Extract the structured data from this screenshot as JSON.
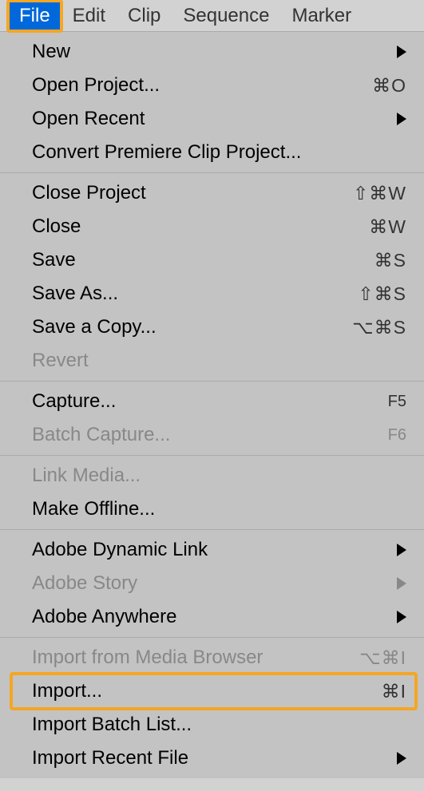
{
  "menubar": {
    "file": "File",
    "edit": "Edit",
    "clip": "Clip",
    "sequence": "Sequence",
    "marker": "Marker"
  },
  "dropdown": {
    "section1": {
      "new": "New",
      "open_project": "Open Project...",
      "open_project_shortcut": "⌘O",
      "open_recent": "Open Recent",
      "convert_premiere": "Convert Premiere Clip Project..."
    },
    "section2": {
      "close_project": "Close Project",
      "close_project_shortcut": "⇧⌘W",
      "close": "Close",
      "close_shortcut": "⌘W",
      "save": "Save",
      "save_shortcut": "⌘S",
      "save_as": "Save As...",
      "save_as_shortcut": "⇧⌘S",
      "save_copy": "Save a Copy...",
      "save_copy_shortcut": "⌥⌘S",
      "revert": "Revert"
    },
    "section3": {
      "capture": "Capture...",
      "capture_shortcut": "F5",
      "batch_capture": "Batch Capture...",
      "batch_capture_shortcut": "F6"
    },
    "section4": {
      "link_media": "Link Media...",
      "make_offline": "Make Offline..."
    },
    "section5": {
      "adobe_dynamic": "Adobe Dynamic Link",
      "adobe_story": "Adobe Story",
      "adobe_anywhere": "Adobe Anywhere"
    },
    "section6": {
      "import_media_browser": "Import from Media Browser",
      "import_media_browser_shortcut": "⌥⌘I",
      "import": "Import...",
      "import_shortcut": "⌘I",
      "import_batch": "Import Batch List...",
      "import_recent": "Import Recent File"
    }
  }
}
